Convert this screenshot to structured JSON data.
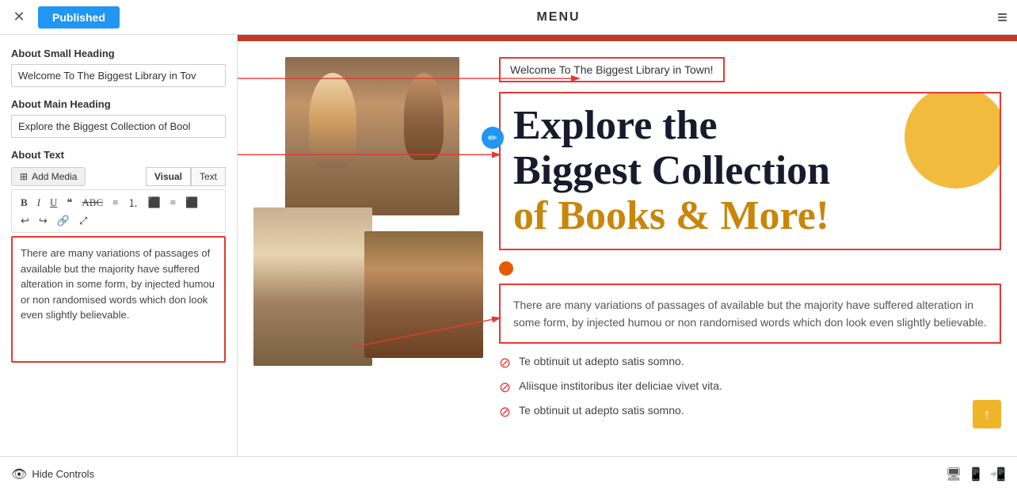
{
  "topbar": {
    "close_icon": "✕",
    "published_label": "Published",
    "menu_label": "MENU",
    "hamburger_icon": "≡"
  },
  "left_panel": {
    "small_heading_label": "About Small Heading",
    "small_heading_value": "Welcome To The Biggest Library in Tov",
    "main_heading_label": "About Main Heading",
    "main_heading_value": "Explore the Biggest Collection of Bool",
    "about_text_label": "About Text",
    "add_media_label": "Add Media",
    "visual_tab": "Visual",
    "text_tab": "Text",
    "body_text": "There are many variations of passages of available but the majority have suffered alteration in some form, by injected humou or non randomised words which don look even slightly believable.",
    "hide_controls_label": "Hide Controls"
  },
  "right_panel": {
    "small_heading": "Welcome To The Biggest Library in Town!",
    "main_heading_line1": "Explore the",
    "main_heading_line2": "Biggest Collection",
    "main_heading_line3": "of Books & More!",
    "body_text": "There are many variations of passages of available but the majority have suffered alteration in some form, by injected humou or non randomised words which don look even slightly believable.",
    "bullet1": "Te obtinuit ut adepto satis somno.",
    "bullet2": "Aliisque institoribus iter deliciae vivet vita.",
    "bullet3": "Te obtinuit ut adepto satis somno."
  }
}
